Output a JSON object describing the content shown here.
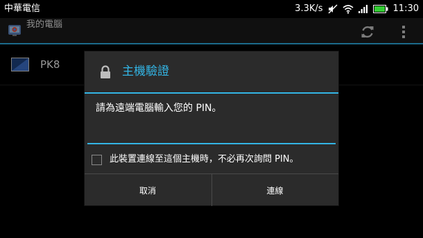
{
  "status_bar": {
    "carrier": "中華電信",
    "data_speed": "3.3K/s",
    "time": "11:30",
    "icons": [
      "mute-icon",
      "wifi-icon",
      "signal-icon",
      "battery-icon"
    ],
    "battery_color": "#33cc33"
  },
  "app_bar": {
    "title": "我的電腦",
    "refresh_icon": "refresh-icon",
    "overflow_icon": "overflow-menu-icon"
  },
  "hosts": [
    {
      "name": "PK8",
      "icon": "monitor-icon"
    }
  ],
  "dialog": {
    "title": "主機驗證",
    "title_icon": "lock-icon",
    "message": "請為遠端電腦輸入您的 PIN。",
    "pin_value": "",
    "checkbox_label": "此裝置連線至這個主機時，不必再次詢問 PIN。",
    "checkbox_checked": false,
    "cancel_label": "取消",
    "connect_label": "連線"
  },
  "colors": {
    "accent": "#33b5e5",
    "background": "#000000",
    "dialog_bg": "#2b2b2b"
  }
}
